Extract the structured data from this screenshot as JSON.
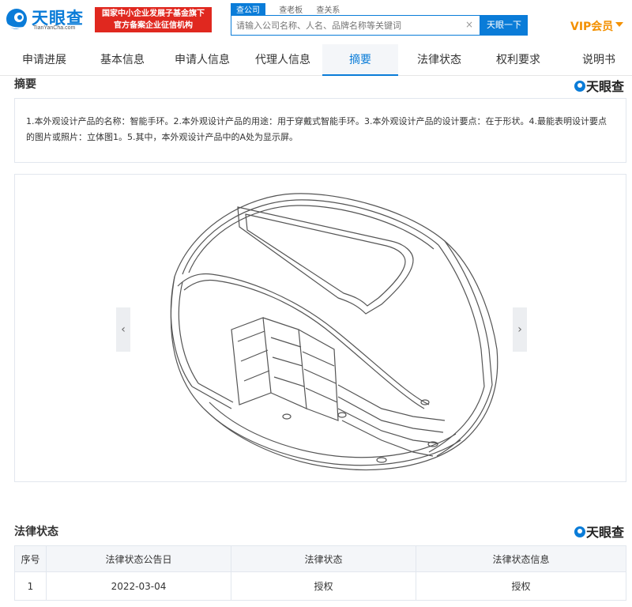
{
  "header": {
    "logo_text": "天眼查",
    "logo_sub": "TianYanCha.com",
    "banner_line1": "国家中小企业发展子基金旗下",
    "banner_line2": "官方备案企业征信机构",
    "search_tabs": [
      "查公司",
      "查老板",
      "查关系"
    ],
    "search_placeholder": "请输入公司名称、人名、品牌名称等关键词",
    "search_clear": "×",
    "search_button": "天眼一下",
    "vip_label": "VIP会员"
  },
  "nav": {
    "items": [
      "申请进展",
      "基本信息",
      "申请人信息",
      "代理人信息",
      "摘要",
      "法律状态",
      "权利要求",
      "说明书"
    ],
    "active": "摘要"
  },
  "abstract": {
    "title": "摘要",
    "brand": "天眼查",
    "text": "1.本外观设计产品的名称：智能手环。2.本外观设计产品的用途：用于穿戴式智能手环。3.本外观设计产品的设计要点：在于形状。4.最能表明设计要点的图片或照片：立体图1。5.其中，本外观设计产品中的A处为显示屏。"
  },
  "image_viewer": {
    "prev": "‹",
    "next": "›"
  },
  "legal_status": {
    "title": "法律状态",
    "brand": "天眼查",
    "columns": [
      "序号",
      "法律状态公告日",
      "法律状态",
      "法律状态信息"
    ],
    "rows": [
      [
        "1",
        "2022-03-04",
        "授权",
        "授权"
      ]
    ]
  },
  "colors": {
    "brand_blue": "#0a7cd8",
    "banner_red": "#e0281f",
    "vip_orange": "#f39000"
  }
}
